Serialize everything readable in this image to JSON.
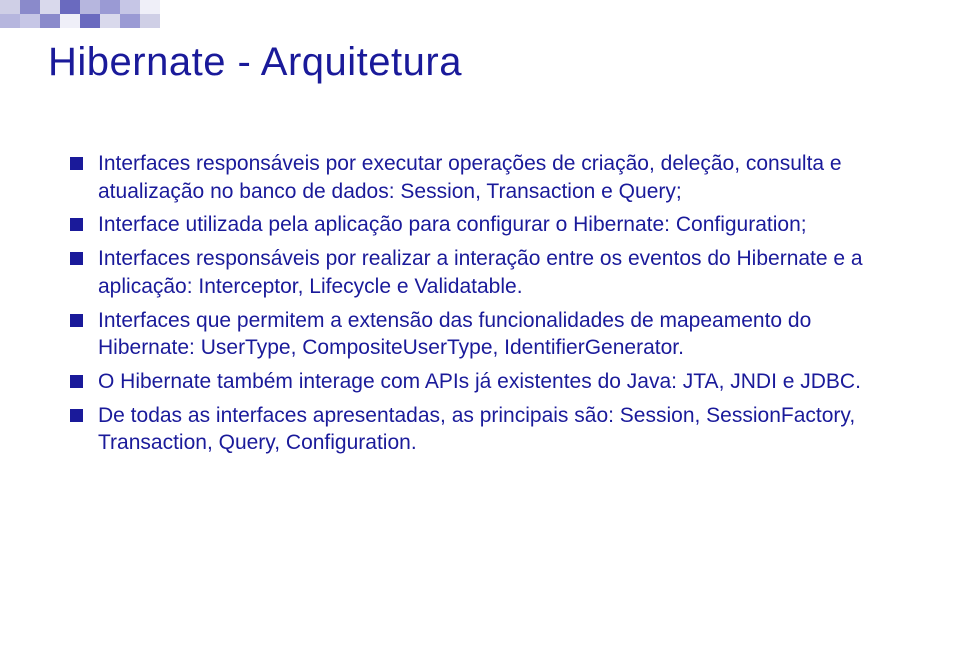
{
  "title": "Hibernate - Arquitetura",
  "bullets": [
    "Interfaces responsáveis por executar operações de criação, deleção, consulta e atualização no banco de dados: Session, Transaction e Query;",
    "Interface utilizada pela aplicação para configurar o Hibernate: Configuration;",
    "Interfaces responsáveis por realizar a interação entre os eventos do Hibernate e a aplicação: Interceptor, Lifecycle e Validatable.",
    "Interfaces que permitem a extensão das funcionalidades de mapeamento do Hibernate: UserType, CompositeUserType, IdentifierGenerator.",
    "O Hibernate também interage com APIs já existentes do Java: JTA, JNDI e JDBC.",
    "De todas as interfaces apresentadas, as principais são: Session, SessionFactory, Transaction, Query, Configuration."
  ]
}
